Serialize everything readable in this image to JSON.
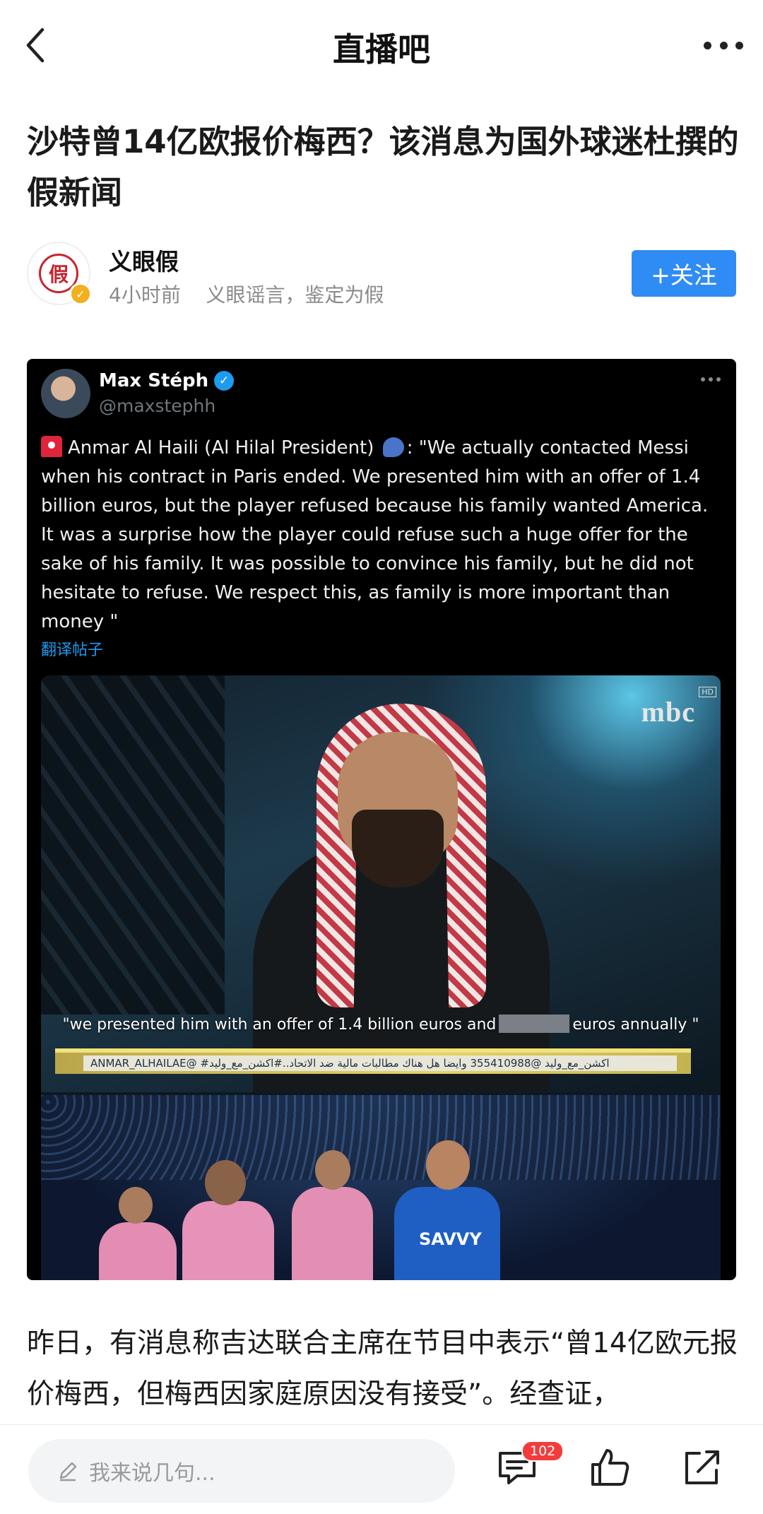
{
  "nav": {
    "title": "直播吧"
  },
  "article": {
    "headline": "沙特曾14亿欧报价梅西？该消息为国外球迷杜撰的假新闻",
    "author": {
      "avatar_text": "假",
      "name": "义眼假",
      "time": "4小时前",
      "tagline": "义眼谣言，鉴定为假",
      "follow_label": "+关注"
    },
    "body": "昨日，有消息称吉达联合主席在节目中表示“曾14亿欧元报价梅西，但梅西因家庭原因没有接受”。经查证，"
  },
  "tweet": {
    "display_name": "Max Stéph",
    "handle": "@maxstephh",
    "text_part1": "Anmar Al Haili  (Al Hilal President)",
    "text_part2": ": \"We actually contacted Messi when his contract in Paris ended. We presented him with an offer of 1.4 billion euros, but the player refused because his family wanted America. It was a surprise how the player could refuse such a huge offer for the sake of his family. It was possible to convince his family, but he did not hesitate to refuse. We respect this, as family is more important than money \"",
    "translate_label": "翻译帖子",
    "media": {
      "tv_logo": "mbc",
      "tv_hd": "HD",
      "subtitle_before": "\"we presented him with an offer of 1.4 billion euros and",
      "subtitle_after": "euros annually \"",
      "ticker": "ANMAR_ALHAILAE@ #اكشن_مع_وليد @355410988 وايضا هل هناك مطالبات مالية ضد الاتحاد..#اكشن_مع_وليد",
      "jersey_text": "SAVVY"
    }
  },
  "bottom_bar": {
    "comment_placeholder": "我来说几句...",
    "comment_count": "102"
  },
  "colors": {
    "accent": "#2f8cf4",
    "badge": "#f23c3c",
    "verified": "#f2b01e",
    "twitter_blue": "#1d9bf0"
  }
}
